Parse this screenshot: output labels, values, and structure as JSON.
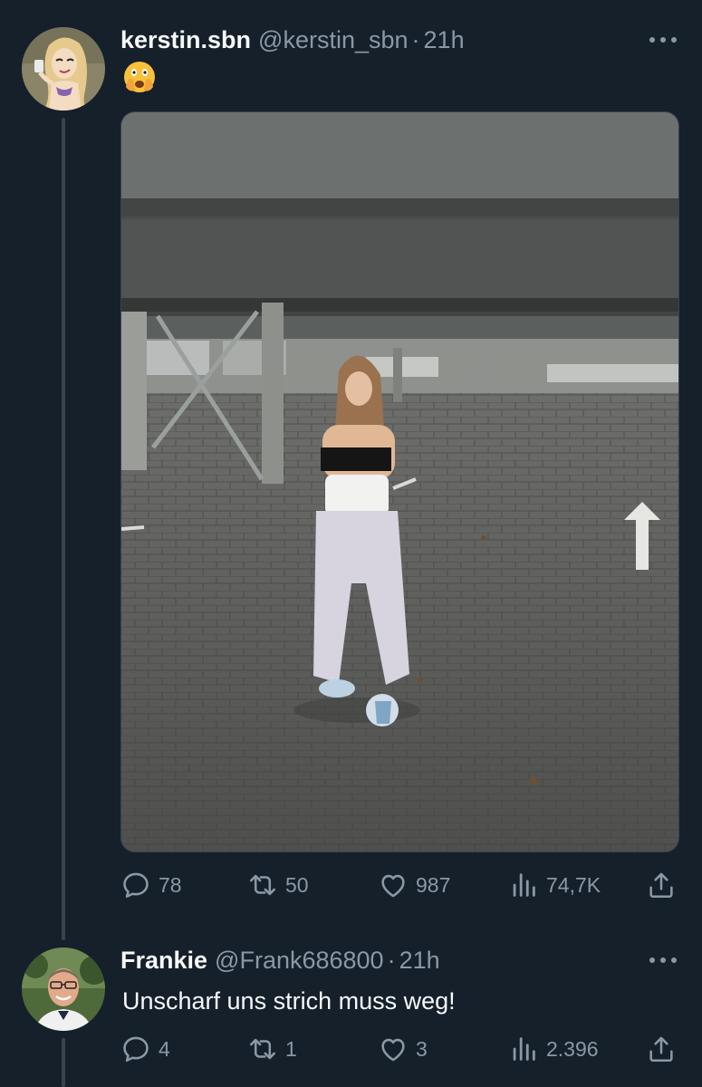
{
  "tweet": {
    "display_name": "kerstin.sbn",
    "handle": "@kerstin_sbn",
    "separator": "·",
    "time": "21h",
    "emoji_icon": "face-with-hand-over-mouth-emoji",
    "media_icon": "parking-garage-photo",
    "stats": {
      "replies": "78",
      "reposts": "50",
      "likes": "987",
      "views": "74,7K"
    }
  },
  "reply": {
    "display_name": "Frankie",
    "handle": "@Frank686800",
    "separator": "·",
    "time": "21h",
    "text": "Unscharf uns strich muss weg!",
    "stats": {
      "replies": "4",
      "reposts": "1",
      "likes": "3",
      "views": "2.396"
    }
  },
  "colors": {
    "background": "#15202b",
    "secondary_text": "#8b98a5",
    "primary_text": "#f7f9f9",
    "thread_line": "#38444d"
  },
  "icons": {
    "reply": "speech-bubble-icon",
    "repost": "repost-arrows-icon",
    "like": "heart-icon",
    "views": "bar-chart-icon",
    "share": "share-upload-icon",
    "more": "more-dots-icon"
  }
}
